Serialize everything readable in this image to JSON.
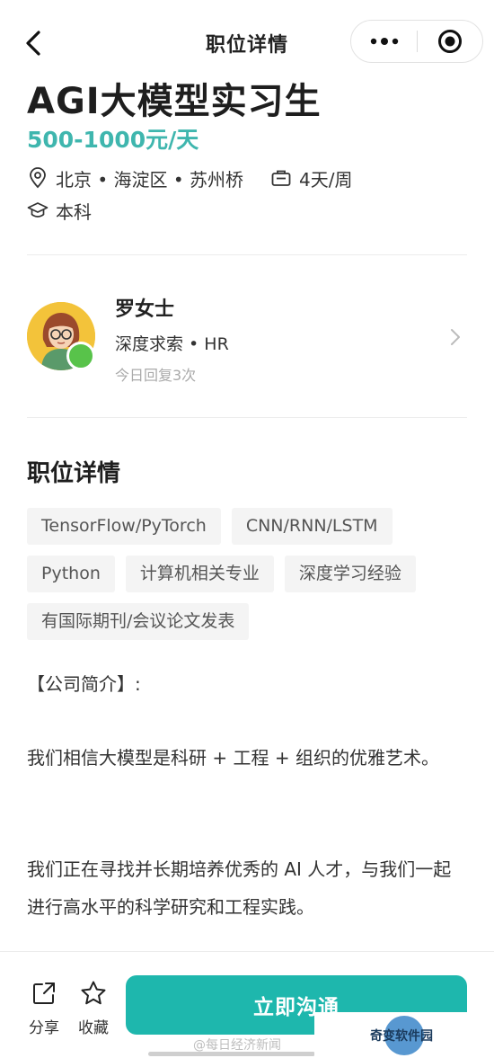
{
  "nav": {
    "title": "职位详情"
  },
  "job": {
    "title": "AGI大模型实习生",
    "salary": "500-1000元/天",
    "location": "北京 • 海淀区 • 苏州桥",
    "schedule": "4天/周",
    "degree": "本科"
  },
  "recruiter": {
    "name": "罗女士",
    "company_role": "深度求索  •  HR",
    "reply_stat": "今日回复3次"
  },
  "details": {
    "title": "职位详情",
    "tags": [
      "TensorFlow/PyTorch",
      "CNN/RNN/LSTM",
      "Python",
      "计算机相关专业",
      "深度学习经验",
      "有国际期刊/会议论文发表"
    ],
    "paragraphs": [
      "【公司简介】:",
      "我们相信大模型是科研 + 工程 + 组织的优雅艺术。",
      "我们正在寻找并长期培养优秀的 AI 人才，与我们一起进行高水平的科学研究和工程实践。"
    ]
  },
  "bottom_bar": {
    "share_label": "分享",
    "favorite_label": "收藏",
    "chat_label": "立即沟通"
  },
  "watermark": {
    "weibo": "@每日经济新闻",
    "site": "奇变软件园"
  },
  "colors": {
    "accent": "#1eb7ad",
    "salary": "#3fb6ae",
    "online": "#58c34a"
  }
}
